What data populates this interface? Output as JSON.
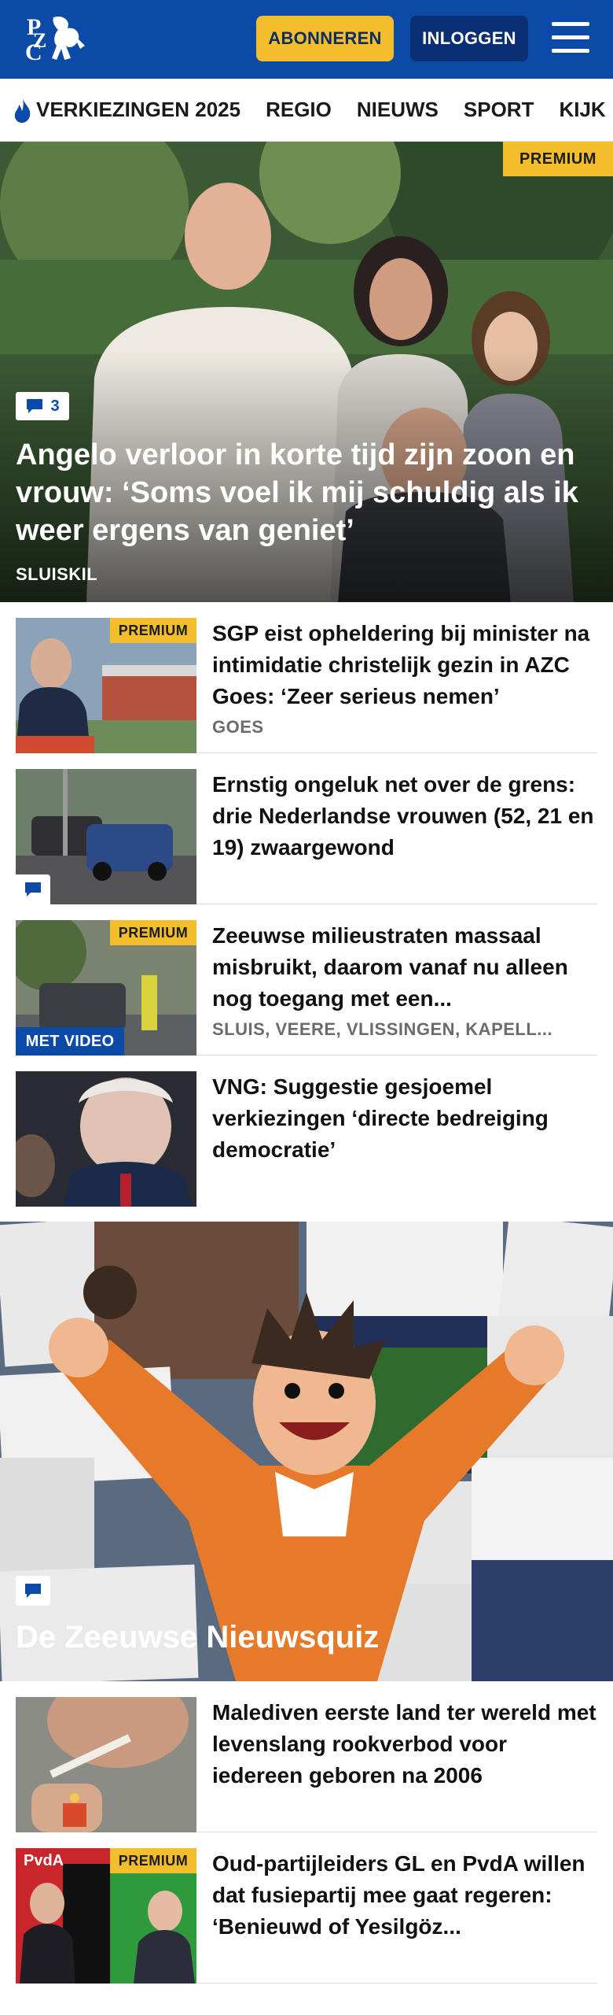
{
  "header": {
    "logo_text": "PZC",
    "subscribe_label": "ABONNEREN",
    "login_label": "INLOGGEN",
    "menu_icon": "hamburger-menu-icon",
    "brand_color": "#0b4aa6",
    "accent_color": "#f3bd2b"
  },
  "nav": {
    "items": [
      {
        "label": "VERKIEZINGEN 2025",
        "icon": "flame-icon"
      },
      {
        "label": "REGIO"
      },
      {
        "label": "NIEUWS"
      },
      {
        "label": "SPORT"
      },
      {
        "label": "KIJK"
      }
    ]
  },
  "hero": {
    "premium_label": "PREMIUM",
    "comment_count": "3",
    "title": "Angelo verloor in korte tijd zijn zoon en vrouw: ‘Soms voel ik mij schuldig als ik weer ergens van geniet’",
    "location": "SLUISKIL"
  },
  "articles": [
    {
      "title": "SGP eist opheldering bij minister na intimidatie christelijk gezin in AZC Goes: ‘Zeer serieus nemen’",
      "location": "GOES",
      "premium_label": "PREMIUM"
    },
    {
      "title": "Ernstig ongeluk net over de grens: drie Nederlandse vrouwen (52, 21 en 19) zwaargewond"
    },
    {
      "title": "Zeeuwse milieustraten massaal misbruikt, daarom vanaf nu alleen nog toegang met een...",
      "location": "SLUIS, VEERE, VLISSINGEN, KAPELL...",
      "premium_label": "PREMIUM",
      "video_label": "MET VIDEO"
    },
    {
      "title": "VNG: Suggestie gesjoemel verkiezingen ‘directe bedreiging democratie’"
    },
    {
      "title": "Malediven eerste land ter wereld met levenslang rookverbod voor iedereen geboren na 2006"
    },
    {
      "title": "Oud-partijleiders GL en PvdA willen dat fusiepartij mee gaat regeren: ‘Benieuwd of Yesilgöz...",
      "premium_label": "PREMIUM"
    }
  ],
  "quiz": {
    "title": "De Zeeuwse Nieuwsquiz"
  }
}
